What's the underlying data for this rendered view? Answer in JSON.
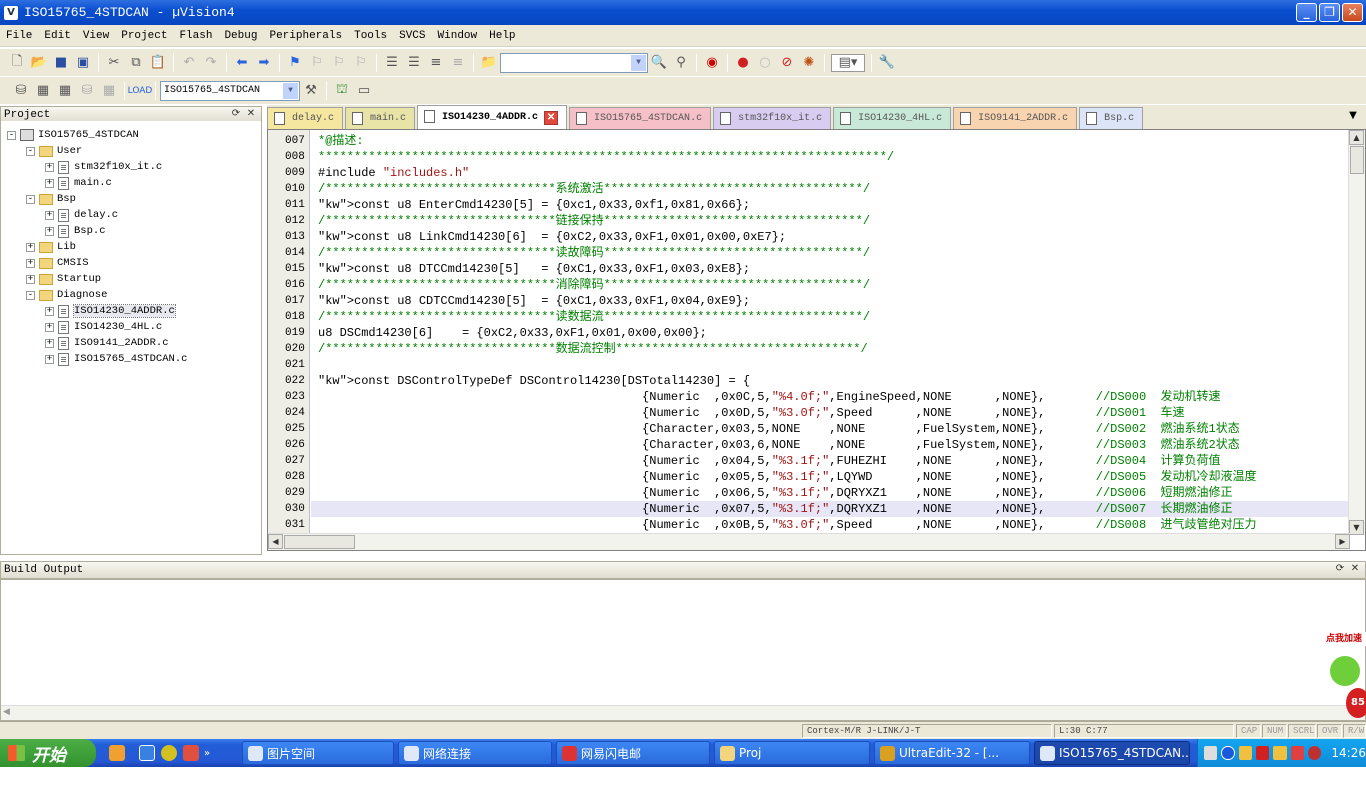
{
  "window": {
    "title": "ISO15765_4STDCAN  - µVision4"
  },
  "menu": [
    "File",
    "Edit",
    "View",
    "Project",
    "Flash",
    "Debug",
    "Peripherals",
    "Tools",
    "SVCS",
    "Window",
    "Help"
  ],
  "toolbar": {
    "target_combo": "ISO15765_4STDCAN",
    "find_combo": ""
  },
  "project_panel": {
    "title": "Project",
    "tree": [
      {
        "label": "ISO15765_4STDCAN",
        "level": 0,
        "kind": "project",
        "exp": "-"
      },
      {
        "label": "User",
        "level": 1,
        "kind": "folder",
        "exp": "-"
      },
      {
        "label": "stm32f10x_it.c",
        "level": 2,
        "kind": "file",
        "exp": "+"
      },
      {
        "label": "main.c",
        "level": 2,
        "kind": "file",
        "exp": "+"
      },
      {
        "label": "Bsp",
        "level": 1,
        "kind": "folder",
        "exp": "-"
      },
      {
        "label": "delay.c",
        "level": 2,
        "kind": "file",
        "exp": "+"
      },
      {
        "label": "Bsp.c",
        "level": 2,
        "kind": "file",
        "exp": "+"
      },
      {
        "label": "Lib",
        "level": 1,
        "kind": "folder",
        "exp": "+"
      },
      {
        "label": "CMSIS",
        "level": 1,
        "kind": "folder",
        "exp": "+"
      },
      {
        "label": "Startup",
        "level": 1,
        "kind": "folder",
        "exp": "+"
      },
      {
        "label": "Diagnose",
        "level": 1,
        "kind": "folder",
        "exp": "-"
      },
      {
        "label": "ISO14230_4ADDR.c",
        "level": 2,
        "kind": "file",
        "exp": "+",
        "selected": true
      },
      {
        "label": "ISO14230_4HL.c",
        "level": 2,
        "kind": "file",
        "exp": "+"
      },
      {
        "label": "ISO9141_2ADDR.c",
        "level": 2,
        "kind": "file",
        "exp": "+"
      },
      {
        "label": "ISO15765_4STDCAN.c",
        "level": 2,
        "kind": "file",
        "exp": "+"
      }
    ]
  },
  "tabs": [
    {
      "label": "delay.c",
      "color": "#f5e6a0"
    },
    {
      "label": "main.c",
      "color": "#e8e4a8"
    },
    {
      "label": "ISO14230_4ADDR.c",
      "color": "#ffffff",
      "active": true
    },
    {
      "label": "ISO15765_4STDCAN.c",
      "color": "#f6c0c8"
    },
    {
      "label": "stm32f10x_it.c",
      "color": "#d8ccf0"
    },
    {
      "label": "ISO14230_4HL.c",
      "color": "#c8e8d8"
    },
    {
      "label": "ISO9141_2ADDR.c",
      "color": "#f8d4b0"
    },
    {
      "label": "Bsp.c",
      "color": "#dce4f8"
    }
  ],
  "editor": {
    "line_numbers": [
      "007",
      "008",
      "009",
      "010",
      "011",
      "012",
      "013",
      "014",
      "015",
      "016",
      "017",
      "018",
      "019",
      "020",
      "021",
      "022",
      "023",
      "024",
      "025",
      "026",
      "027",
      "028",
      "029",
      "030",
      "031"
    ],
    "lines": [
      "*@描述:",
      "*******************************************************************************/",
      "#include \"includes.h\"",
      "/********************************系统激活************************************/",
      "const u8 EnterCmd14230[5] = {0xc1,0x33,0xf1,0x81,0x66};",
      "/********************************链接保持************************************/",
      "const u8 LinkCmd14230[6]  = {0xC2,0x33,0xF1,0x01,0x00,0xE7};",
      "/********************************读故障码************************************/",
      "const u8 DTCCmd14230[5]   = {0xC1,0x33,0xF1,0x03,0xE8};",
      "/********************************消除障码************************************/",
      "const u8 CDTCCmd14230[5]  = {0xC1,0x33,0xF1,0x04,0xE9};",
      "/********************************读数据流************************************/",
      "u8 DSCmd14230[6]    = {0xC2,0x33,0xF1,0x01,0x00,0x00};",
      "/********************************数据流控制**********************************/",
      "",
      "const DSControlTypeDef DSControl14230[DSTotal14230] = {",
      "                                             {Numeric  ,0x0C,5,\"%4.0f;\",EngineSpeed,NONE      ,NONE},       //DS000  发动机转速",
      "                                             {Numeric  ,0x0D,5,\"%3.0f;\",Speed      ,NONE      ,NONE},       //DS001  车速",
      "                                             {Character,0x03,5,NONE    ,NONE       ,FuelSystem,NONE},       //DS002  燃油系统1状态",
      "                                             {Character,0x03,6,NONE    ,NONE       ,FuelSystem,NONE},       //DS003  燃油系统2状态",
      "                                             {Numeric  ,0x04,5,\"%3.1f;\",FUHEZHI    ,NONE      ,NONE},       //DS004  计算负荷值",
      "                                             {Numeric  ,0x05,5,\"%3.1f;\",LQYWD      ,NONE      ,NONE},       //DS005  发动机冷却液温度",
      "                                             {Numeric  ,0x06,5,\"%3.1f;\",DQRYXZ1    ,NONE      ,NONE},       //DS006  短期燃油修正",
      "                                             {Numeric  ,0x07,5,\"%3.1f;\",DQRYXZ1    ,NONE      ,NONE},       //DS007  长期燃油修正",
      "                                             {Numeric  ,0x0B,5,\"%3.0f;\",Speed      ,NONE      ,NONE},       //DS008  进气歧管绝对压力"
    ]
  },
  "build_output": {
    "title": "Build Output"
  },
  "status": {
    "debugger": "Cortex-M/R J-LINK/J-T",
    "position": "L:30 C:77",
    "caps": "CAP",
    "num": "NUM",
    "scrl": "SCRL",
    "ovr": "OVR",
    "rw": "R/W"
  },
  "taskbar": {
    "start": "开始",
    "tasks": [
      "图片空间",
      "网络连接",
      "网易闪电邮",
      "Proj",
      "UltraEdit-32 - [...",
      "ISO15765_4STDCAN..."
    ],
    "clock": "14:26"
  },
  "promo": {
    "label": "点我加速",
    "value": "85"
  }
}
